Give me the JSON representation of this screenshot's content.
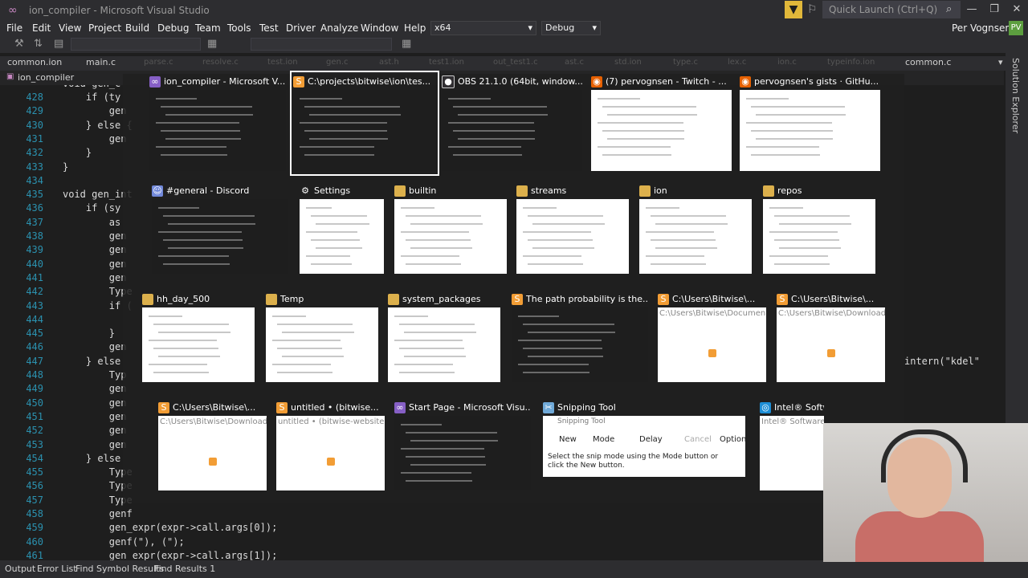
{
  "titlebar": {
    "title": "ion_compiler - Microsoft Visual Studio",
    "quick_launch_placeholder": "Quick Launch (Ctrl+Q)",
    "minimize": "—",
    "restore": "❐",
    "close": "✕"
  },
  "menu": {
    "items": [
      "File",
      "Edit",
      "View",
      "Project",
      "Build",
      "Debug",
      "Team",
      "Tools",
      "Test",
      "Driver",
      "Analyze",
      "Window",
      "Help"
    ],
    "platform": "x64",
    "config": "Debug",
    "user": "Per Vognsen",
    "user_initials": "PV"
  },
  "tabs": {
    "left": [
      "common.ion",
      "main.c"
    ],
    "ghost": [
      "parse.c",
      "resolve.c",
      "test.ion",
      "gen.c",
      "ast.h",
      "test1.ion",
      "out_test1.c",
      "ast.c",
      "std.ion",
      "type.c",
      "lex.c",
      "ion.c",
      "typeinfo.ion"
    ],
    "right": "common.c"
  },
  "breadcrumb": {
    "project": "ion_compiler"
  },
  "sidebar": {
    "solution_explorer": "Solution Explorer"
  },
  "editor": {
    "lines": [
      {
        "n": "428",
        "t": "    if (ty"
      },
      {
        "n": "429",
        "t": "        gen"
      },
      {
        "n": "430",
        "t": "    } else {"
      },
      {
        "n": "431",
        "t": "        gen"
      },
      {
        "n": "432",
        "t": "    }"
      },
      {
        "n": "433",
        "t": "}"
      },
      {
        "n": "434",
        "t": ""
      },
      {
        "n": "435",
        "t": "void gen_int"
      },
      {
        "n": "436",
        "t": "    if (sy"
      },
      {
        "n": "437",
        "t": "        as"
      },
      {
        "n": "438",
        "t": "        gen"
      },
      {
        "n": "439",
        "t": "        gen"
      },
      {
        "n": "440",
        "t": "        gen"
      },
      {
        "n": "441",
        "t": "        gen"
      },
      {
        "n": "442",
        "t": "        Type"
      },
      {
        "n": "443",
        "t": "        if ("
      },
      {
        "n": "444",
        "t": ""
      },
      {
        "n": "445",
        "t": "        }"
      },
      {
        "n": "446",
        "t": "        gen"
      },
      {
        "n": "447",
        "t": "    } else"
      },
      {
        "n": "448",
        "t": "        Typ"
      },
      {
        "n": "449",
        "t": "        gen"
      },
      {
        "n": "450",
        "t": "        gen"
      },
      {
        "n": "451",
        "t": "        gen"
      },
      {
        "n": "452",
        "t": "        gen"
      },
      {
        "n": "453",
        "t": "        gen"
      },
      {
        "n": "454",
        "t": "    } else"
      },
      {
        "n": "455",
        "t": "        Type"
      },
      {
        "n": "456",
        "t": "        Type"
      },
      {
        "n": "457",
        "t": "        Type"
      },
      {
        "n": "458",
        "t": "        genf"
      },
      {
        "n": "459",
        "t": "        gen_expr(expr->call.args[0]);"
      },
      {
        "n": "460",
        "t": "        genf(\"), (\");"
      },
      {
        "n": "461",
        "t": "        gen_expr(expr->call.args[1]);"
      }
    ],
    "line_427_fragment": "void gen_c",
    "right_fragment": "intern(\"kdel\""
  },
  "switcher": {
    "row1": [
      {
        "title": "ion_compiler - Microsoft V...",
        "icon": "visual-studio-icon",
        "thumb": "dark"
      },
      {
        "title": "C:\\projects\\bitwise\\ion\\tes...",
        "icon": "sublime-icon",
        "thumb": "dark",
        "selected": true
      },
      {
        "title": "OBS 21.1.0 (64bit, window...",
        "icon": "obs-icon",
        "thumb": "dark"
      },
      {
        "title": "(7) pervognsen - Twitch - ...",
        "icon": "firefox-icon",
        "thumb": "light"
      },
      {
        "title": "pervognsen's gists · GitHu...",
        "icon": "firefox-icon",
        "thumb": "light"
      }
    ],
    "row2": [
      {
        "title": "#general - Discord",
        "icon": "discord-icon",
        "thumb": "dark"
      },
      {
        "title": "Settings",
        "icon": "gear-icon",
        "thumb": "light"
      },
      {
        "title": "builtin",
        "icon": "folder-icon",
        "thumb": "light"
      },
      {
        "title": "streams",
        "icon": "folder-icon",
        "thumb": "light"
      },
      {
        "title": "ion",
        "icon": "folder-icon",
        "thumb": "light"
      },
      {
        "title": "repos",
        "icon": "folder-icon",
        "thumb": "light"
      }
    ],
    "row3": [
      {
        "title": "hh_day_500",
        "icon": "folder-icon",
        "thumb": "light"
      },
      {
        "title": "Temp",
        "icon": "folder-icon",
        "thumb": "light"
      },
      {
        "title": "system_packages",
        "icon": "folder-icon",
        "thumb": "light"
      },
      {
        "title": "The path probability is the...",
        "icon": "sublime-icon",
        "thumb": "dark"
      },
      {
        "title": "C:\\Users\\Bitwise\\...",
        "icon": "sublime-icon",
        "thumb": "light",
        "ghost": "C:\\Users\\Bitwise\\Documen..."
      },
      {
        "title": "C:\\Users\\Bitwise\\...",
        "icon": "sublime-icon",
        "thumb": "light",
        "ghost": "C:\\Users\\Bitwise\\Download..."
      }
    ],
    "row4": [
      {
        "title": "C:\\Users\\Bitwise\\...",
        "icon": "sublime-icon",
        "thumb": "light",
        "ghost": "C:\\Users\\Bitwise\\Download..."
      },
      {
        "title": "untitled • (bitwise...",
        "icon": "sublime-icon",
        "thumb": "light",
        "ghost": "untitled • (bitwise-website)..."
      },
      {
        "title": "Start Page - Microsoft Visu...",
        "icon": "visual-studio-icon",
        "thumb": "dark"
      },
      {
        "title": "Snipping Tool",
        "icon": "snipping-tool-icon",
        "thumb": "light"
      },
      {
        "title": "Intel® Software...",
        "icon": "intel-icon",
        "thumb": "light",
        "ghost": "Intel® Software"
      }
    ],
    "snipping": {
      "header": "Snipping Tool",
      "new": "New",
      "mode": "Mode",
      "delay": "Delay",
      "cancel": "Cancel",
      "options": "Options",
      "hint": "Select the snip mode using the Mode button or click the New button."
    }
  },
  "statusbar": {
    "items": [
      "Output",
      "Error List",
      "Find Symbol Results",
      "Find Results 1"
    ]
  }
}
